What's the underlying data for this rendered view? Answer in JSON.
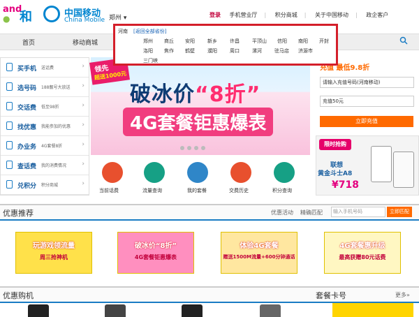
{
  "brand": {
    "and_a": "and",
    "and_b": "●",
    "he": "和",
    "cm_cn": "中国移动",
    "cm_en": "China Mobile"
  },
  "city": "郑州 ▾",
  "toplinks": {
    "login": "登录",
    "hall": "手机营业厅",
    "points": "积分商城",
    "about": "关于中国移动",
    "gov": "政企客户"
  },
  "nav": [
    "首页",
    "移动商城"
  ],
  "dropdown": {
    "province": "河南",
    "back": "[返回全部省份]",
    "row1": [
      "郑州",
      "商丘",
      "安阳",
      "新乡",
      "许昌",
      "平顶山",
      "信阳",
      "南阳",
      "开封"
    ],
    "row2": [
      "洛阳",
      "焦作",
      "鹤壁",
      "濮阳",
      "周口",
      "漯河",
      "驻马店",
      "济源市"
    ],
    "row3": [
      "三门峡"
    ]
  },
  "left_menu": [
    {
      "title": "买手机",
      "sub": "送话费"
    },
    {
      "title": "选号码",
      "sub": "188靓号大放送"
    },
    {
      "title": "交话费",
      "sub": "低至98折"
    },
    {
      "title": "找优惠",
      "sub": "我能参加的优惠"
    },
    {
      "title": "办业务",
      "sub": "4G套餐8折"
    },
    {
      "title": "查话费",
      "sub": "我的消费情况"
    },
    {
      "title": "兑积分",
      "sub": "积分商城"
    }
  ],
  "banner": {
    "tag1": "领先",
    "tag2": "超送1000元",
    "big_a": "破冰价",
    "big_b": "“8折”",
    "sub": "4G套餐钜惠爆表"
  },
  "quick": [
    "当前话费",
    "流量查询",
    "我的套餐",
    "交费历史",
    "积分查询"
  ],
  "colors": {
    "accent": "#1a7cc4",
    "brand": "#0085d0",
    "orange": "#ff6a00",
    "pink": "#e4007f",
    "red": "#d41f2a"
  },
  "right_panel": {
    "head": "充值 最低9.8折",
    "phone_placeholder": "请输入充值号码(河南移动)",
    "amount": "充值50元",
    "button": "立即充值",
    "promo": "限时抢购",
    "product_a": "联想",
    "product_b": "黄金斗士A8",
    "price": "¥718"
  },
  "section1": {
    "title": "优惠推荐",
    "tab1": "优惠活动",
    "tab2": "精确匹配",
    "search_placeholder": "输入手机号码",
    "btn": "立即匹配"
  },
  "promos": [
    {
      "title": "玩游戏领流量",
      "sub": "周三抢神机"
    },
    {
      "title": "破冰价“8折”",
      "sub": "4G套餐钜惠爆表"
    },
    {
      "title": "体验4G套餐",
      "sub": "赠送1500M流量+600分钟通话"
    },
    {
      "title": "4G套餐惠升级",
      "sub": "最高获赠80元话费"
    }
  ],
  "section2": {
    "title": "优惠购机",
    "title2": "套餐卡号",
    "more": "更多»"
  }
}
